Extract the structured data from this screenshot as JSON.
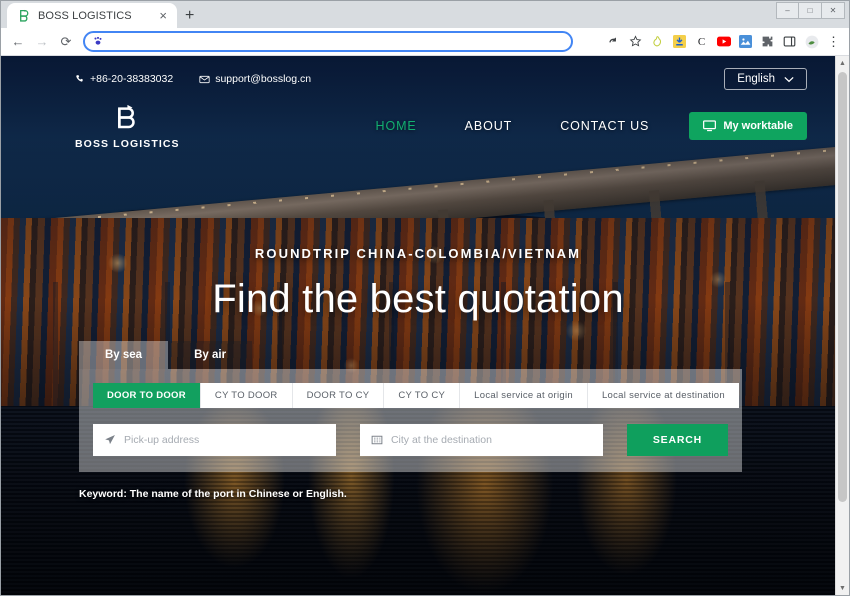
{
  "browser": {
    "tab": {
      "title": "BOSS LOGISTICS",
      "favicon": "boss-b-logo-icon",
      "close": "×"
    },
    "new_tab": "+",
    "window_controls": {
      "minimize": "–",
      "maximize": "□",
      "close": "✕"
    },
    "nav": {
      "back": "←",
      "forward": "→",
      "reload": "⟳"
    },
    "omnibox": {
      "value": "",
      "placeholder": "",
      "site_icon": "paw-site-icon"
    },
    "extensions": [
      {
        "name": "undo-icon",
        "glyph": "↶",
        "color": "#3c4043"
      },
      {
        "name": "bookmark-star-icon",
        "glyph": "☆",
        "color": "#3c4043"
      },
      {
        "name": "pear-extension-icon",
        "glyph": "○",
        "color": "#c8d44a"
      },
      {
        "name": "download-extension-icon",
        "glyph": "⬇",
        "color": "#1a73e8"
      },
      {
        "name": "c-extension-icon",
        "glyph": "C",
        "color": "#202124"
      },
      {
        "name": "youtube-extension-icon",
        "glyph": "▶",
        "color": "#ff0000"
      },
      {
        "name": "image-extension-icon",
        "glyph": "⬛",
        "color": "#4a90d9"
      },
      {
        "name": "puzzle-extensions-icon",
        "glyph": "✦",
        "color": "#5f6368"
      },
      {
        "name": "sidepanel-icon",
        "glyph": "▭",
        "color": "#3c4043"
      },
      {
        "name": "profile-avatar-icon",
        "glyph": "●",
        "color": "#6aa84f"
      },
      {
        "name": "chrome-menu-icon",
        "glyph": "⋮",
        "color": "#3c4043"
      }
    ]
  },
  "site": {
    "topbar": {
      "phone": "+86-20-38383032",
      "phone_icon": "phone-icon",
      "email": "support@bosslog.cn",
      "email_icon": "envelope-icon",
      "language": "English",
      "language_chevron": "⌄"
    },
    "logo": {
      "mark": "boss-b-monogram-icon",
      "text": "BOSS LOGISTICS"
    },
    "nav": [
      {
        "label": "HOME",
        "active": true
      },
      {
        "label": "ABOUT",
        "active": false
      },
      {
        "label": "CONTACT US",
        "active": false
      }
    ],
    "worktable": {
      "label": "My worktable",
      "icon": "monitor-icon"
    },
    "hero": {
      "kicker": "ROUNDTRIP CHINA-COLOMBIA/VIETNAM",
      "headline": "Find the best quotation"
    },
    "search": {
      "mode_tabs": [
        {
          "label": "By sea",
          "active": true
        },
        {
          "label": "By air",
          "active": false
        }
      ],
      "service_tabs": [
        {
          "label": "DOOR TO DOOR",
          "active": true
        },
        {
          "label": "CY TO DOOR",
          "active": false
        },
        {
          "label": "DOOR TO CY",
          "active": false
        },
        {
          "label": "CY TO CY",
          "active": false
        },
        {
          "label": "Local service at origin",
          "active": false
        },
        {
          "label": "Local service at destination",
          "active": false
        }
      ],
      "origin": {
        "placeholder": "Pick-up address",
        "value": "",
        "icon": "location-arrow-icon"
      },
      "destination": {
        "placeholder": "City at the destination",
        "value": "",
        "icon": "city-building-icon"
      },
      "submit": "SEARCH"
    },
    "keyword_hint": "Keyword: The name of the port in Chinese or English."
  },
  "colors": {
    "brand_green": "#0f9f5d",
    "nav_active_green": "#12b070",
    "omnibox_focus_blue": "#4285f4",
    "hero_sky": "#0b2044"
  },
  "scrollbar": {
    "up": "▲",
    "down": "▼"
  }
}
